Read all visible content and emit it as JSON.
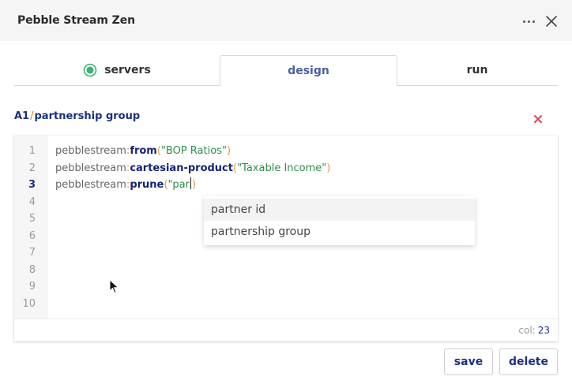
{
  "window": {
    "title": "Pebble Stream Zen"
  },
  "tabs": [
    {
      "label": "servers",
      "icon": "status-dot-icon",
      "status_color": "#3cb46e"
    },
    {
      "label": "design",
      "active": true
    },
    {
      "label": "run"
    }
  ],
  "breadcrumb": {
    "parent": "A1",
    "separator": "/",
    "current": "partnership group"
  },
  "editor": {
    "line_numbers": [
      "1",
      "2",
      "3",
      "4",
      "5",
      "6",
      "7",
      "8",
      "9",
      "10"
    ],
    "active_line": "3",
    "lines": [
      {
        "ns": "pebblestream",
        "colon": ":",
        "fn": "from",
        "open": "(",
        "arg": "\"BOP Ratios\"",
        "close": ")"
      },
      {
        "ns": "pebblestream",
        "colon": ":",
        "fn": "cartesian-product",
        "open": "(",
        "arg": "\"Taxable Income\"",
        "close": ")"
      },
      {
        "ns": "pebblestream",
        "colon": ":",
        "fn": "prune",
        "open": "(",
        "arg": "\"par",
        "close": ")"
      }
    ],
    "col_label": "col:",
    "col_value": "23"
  },
  "autocomplete": {
    "suggestions": [
      "partner id",
      "partnership group"
    ],
    "highlighted_index": 0
  },
  "actions": {
    "save_label": "save",
    "delete_label": "delete"
  },
  "colors": {
    "accent": "#1c2f80",
    "active_tab": "#4a5fa8",
    "remove": "#e0445a",
    "string": "#2e8f4a",
    "punctuation": "#e09a3a"
  }
}
